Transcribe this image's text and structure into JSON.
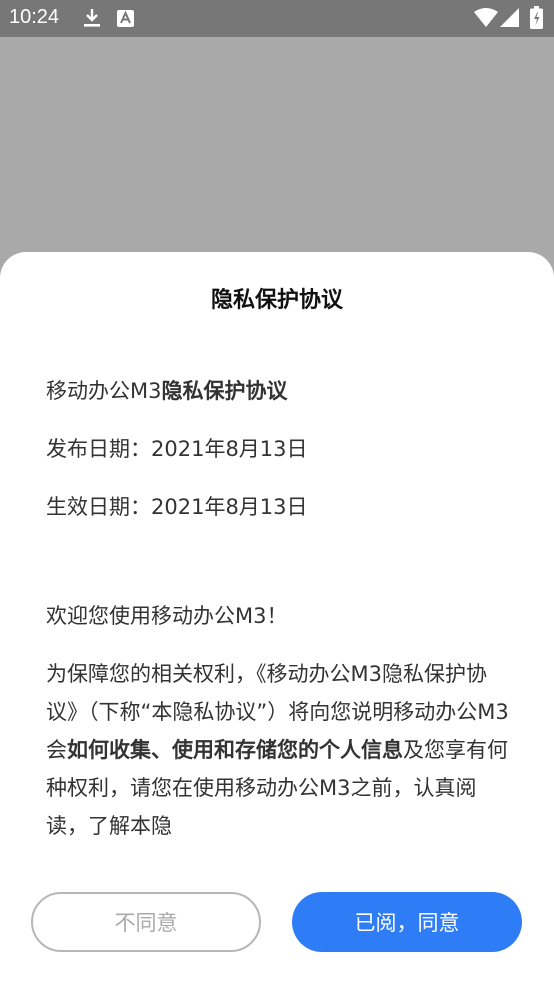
{
  "status_bar": {
    "time": "10:24",
    "icons": [
      "download-icon",
      "a-badge-icon",
      "wifi-icon",
      "signal-icon",
      "battery-icon"
    ]
  },
  "dialog": {
    "title": "隐私保护协议",
    "heading_prefix": "移动办公M3",
    "heading_bold": "隐私保护协议",
    "release_date": "发布日期：2021年8月13日",
    "effective_date": "生效日期：2021年8月13日",
    "welcome": "欢迎您使用移动办公M3！",
    "para_part1": "为保障您的相关权利，《移动办公M3隐私保护协议》（下称“本隐私协议”）将向您说明移动办公M3会",
    "para_bold": "如何收集、使用和存储您的个人信息",
    "para_part2": "及您享有何种权利，请您在使用移动办公M3之前，认真阅读，了解本隐"
  },
  "buttons": {
    "decline": "不同意",
    "agree": "已阅，同意"
  },
  "colors": {
    "accent": "#2f7df6",
    "overlay": "#a9a9a9",
    "status_bar": "#777777"
  }
}
